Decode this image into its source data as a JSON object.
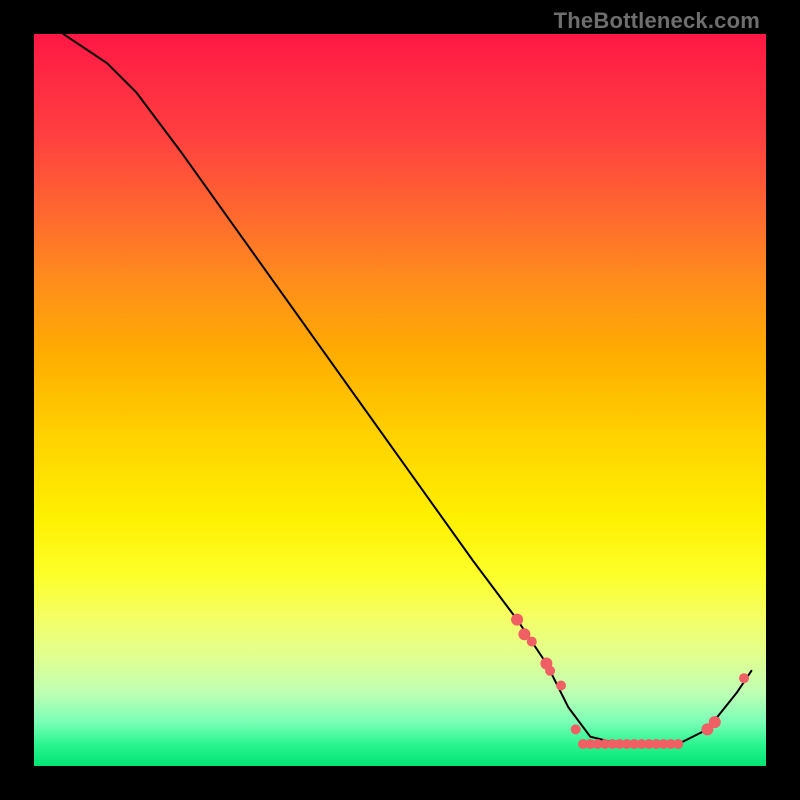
{
  "watermark": {
    "text": "TheBottleneck.com"
  },
  "chart_data": {
    "type": "line",
    "title": "",
    "xlabel": "",
    "ylabel": "",
    "xlim": [
      0,
      100
    ],
    "ylim": [
      0,
      100
    ],
    "grid": false,
    "legend": false,
    "curve": {
      "name": "bottleneck-curve",
      "color": "#000000",
      "points": [
        {
          "x": 4,
          "y": 100
        },
        {
          "x": 7,
          "y": 98
        },
        {
          "x": 10,
          "y": 96
        },
        {
          "x": 14,
          "y": 92
        },
        {
          "x": 20,
          "y": 84
        },
        {
          "x": 30,
          "y": 70
        },
        {
          "x": 40,
          "y": 56
        },
        {
          "x": 50,
          "y": 42
        },
        {
          "x": 60,
          "y": 28
        },
        {
          "x": 66,
          "y": 20
        },
        {
          "x": 70,
          "y": 14
        },
        {
          "x": 73,
          "y": 8
        },
        {
          "x": 76,
          "y": 4
        },
        {
          "x": 80,
          "y": 3
        },
        {
          "x": 84,
          "y": 3
        },
        {
          "x": 88,
          "y": 3
        },
        {
          "x": 92,
          "y": 5
        },
        {
          "x": 96,
          "y": 10
        },
        {
          "x": 98,
          "y": 13
        }
      ]
    },
    "markers": {
      "color": "#ef5f64",
      "points": [
        {
          "x": 66,
          "y": 20,
          "r": 6
        },
        {
          "x": 67,
          "y": 18,
          "r": 6
        },
        {
          "x": 68,
          "y": 17,
          "r": 5
        },
        {
          "x": 70,
          "y": 14,
          "r": 6
        },
        {
          "x": 70.5,
          "y": 13,
          "r": 5
        },
        {
          "x": 72,
          "y": 11,
          "r": 5
        },
        {
          "x": 74,
          "y": 5,
          "r": 5
        },
        {
          "x": 75,
          "y": 3,
          "r": 5
        },
        {
          "x": 76,
          "y": 3,
          "r": 5
        },
        {
          "x": 77,
          "y": 3,
          "r": 5
        },
        {
          "x": 78,
          "y": 3,
          "r": 5
        },
        {
          "x": 79,
          "y": 3,
          "r": 5
        },
        {
          "x": 80,
          "y": 3,
          "r": 5
        },
        {
          "x": 81,
          "y": 3,
          "r": 5
        },
        {
          "x": 82,
          "y": 3,
          "r": 5
        },
        {
          "x": 83,
          "y": 3,
          "r": 5
        },
        {
          "x": 84,
          "y": 3,
          "r": 5
        },
        {
          "x": 85,
          "y": 3,
          "r": 5
        },
        {
          "x": 86,
          "y": 3,
          "r": 5
        },
        {
          "x": 87,
          "y": 3,
          "r": 5
        },
        {
          "x": 88,
          "y": 3,
          "r": 5
        },
        {
          "x": 92,
          "y": 5,
          "r": 6
        },
        {
          "x": 93,
          "y": 6,
          "r": 6
        },
        {
          "x": 97,
          "y": 12,
          "r": 5
        }
      ]
    },
    "background_gradient_stops_pct": [
      {
        "pct": 0,
        "color": "#ff1744"
      },
      {
        "pct": 25,
        "color": "#ff6a2e"
      },
      {
        "pct": 50,
        "color": "#ffd200"
      },
      {
        "pct": 75,
        "color": "#fdff2a"
      },
      {
        "pct": 90,
        "color": "#bfffb4"
      },
      {
        "pct": 100,
        "color": "#00e472"
      }
    ]
  }
}
